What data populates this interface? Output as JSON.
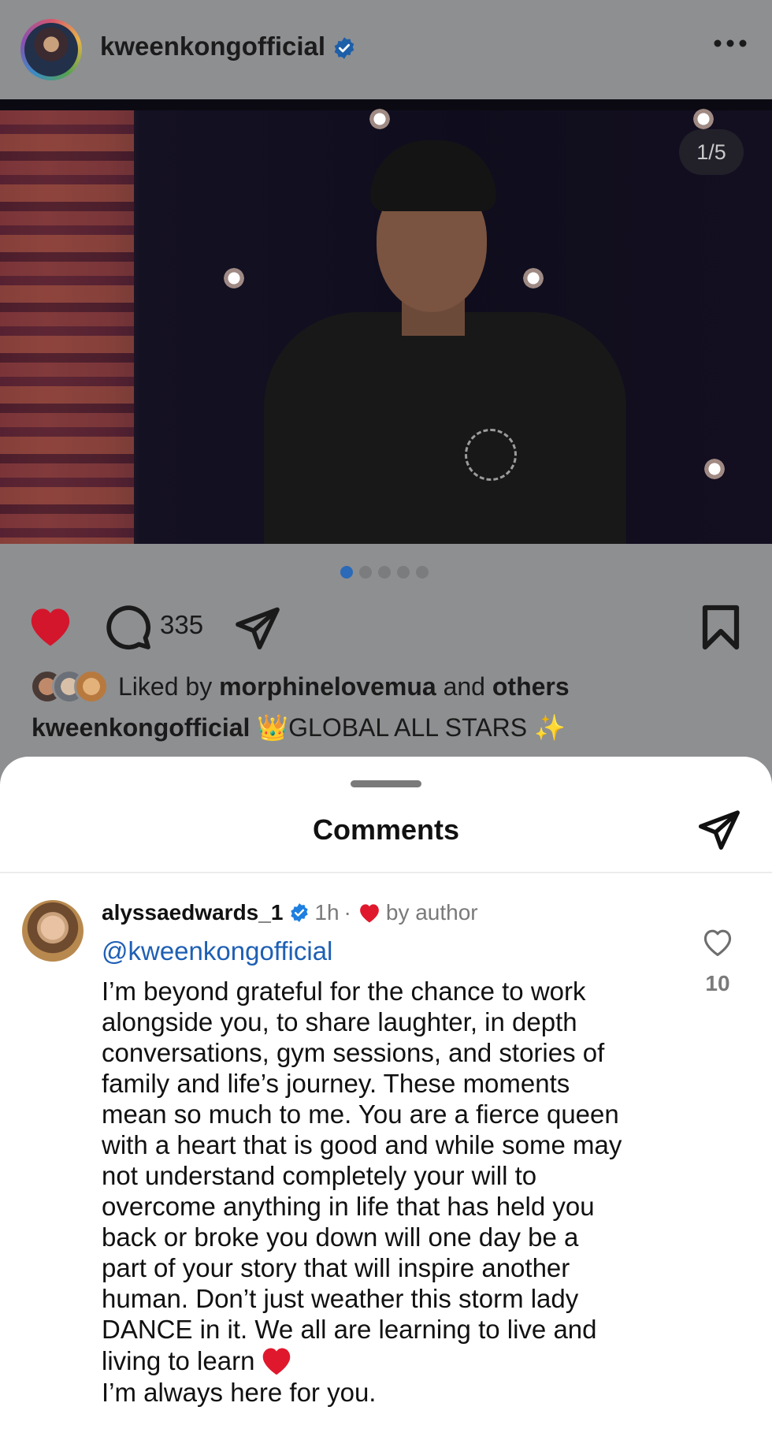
{
  "post": {
    "username": "kweenkongofficial",
    "slide_counter": "1/5",
    "carousel": {
      "total": 5,
      "active": 1
    },
    "comment_count": "335",
    "liked_by_prefix": "Liked by",
    "liked_by_user": "morphinelovemua",
    "liked_by_and": "and",
    "liked_by_others": "others",
    "caption_user": "kweenkongofficial",
    "caption_text": "👑GLOBAL ALL STARS ✨"
  },
  "comments_sheet": {
    "title": "Comments",
    "comment": {
      "username": "alyssaedwards_1",
      "time": "1h",
      "separator": "·",
      "liked_by_author": "by author",
      "mention": "@kweenkongofficial",
      "body": "I’m beyond grateful for the chance to work\nalongside you, to share laughter, in depth\nconversations, gym sessions, and stories of\nfamily and life’s journey. These moments\nmean so much to me. You are a fierce queen\nwith a heart that is good and while some may\nnot understand completely your will to\novercome anything in life that has held you\nback or broke you down will one day be a\npart of your story that will inspire another\nhuman. Don’t just weather this storm lady\nDANCE in it. We all are learning to live and\nliving to learn",
      "tail": "I’m always here for you.",
      "like_count": "10"
    }
  },
  "colors": {
    "dim_background": "#8e8f91",
    "like_red": "#e0182d",
    "link_blue": "#1e5fb4",
    "verified_blue": "#1d7fe0"
  },
  "icons": [
    "more-icon",
    "verified-icon",
    "heart-icon",
    "comment-icon",
    "share-icon",
    "bookmark-icon",
    "heart-outline-icon"
  ]
}
